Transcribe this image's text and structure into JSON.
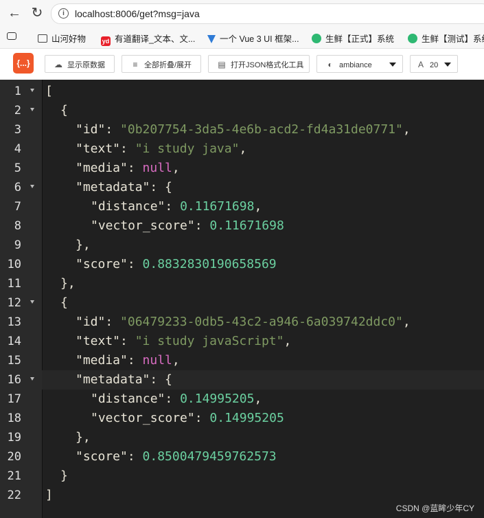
{
  "browser": {
    "url": "localhost:8006/get?msg=java",
    "bookmarks": [
      {
        "label": "山河好物",
        "icon": "folder-icon",
        "color": "#444444"
      },
      {
        "label": "有道翻译_文本、文...",
        "icon": "youdao-icon",
        "color": "#e8202a"
      },
      {
        "label": "一个 Vue 3 UI 框架...",
        "icon": "vue-icon",
        "color": "#2f7bd6"
      },
      {
        "label": "生鲜【正式】系统",
        "icon": "app-icon",
        "color": "#2eb872"
      },
      {
        "label": "生鲜【测试】系统",
        "icon": "app-icon",
        "color": "#2eb872"
      }
    ]
  },
  "toolbar": {
    "logo_text": "{...}",
    "show_raw": "显示原数据",
    "fold_all": "全部折叠/展开",
    "open_tool": "打开JSON格式化工具",
    "theme": "ambiance",
    "font_size": "20"
  },
  "editor": {
    "active_line": 16,
    "lines": [
      {
        "n": "1",
        "fold": true,
        "indent": 0,
        "tokens": [
          {
            "t": "[",
            "c": "p"
          }
        ]
      },
      {
        "n": "2",
        "fold": true,
        "indent": 1,
        "tokens": [
          {
            "t": "{",
            "c": "p"
          }
        ]
      },
      {
        "n": "3",
        "fold": false,
        "indent": 2,
        "tokens": [
          {
            "t": "\"id\"",
            "c": "k"
          },
          {
            "t": ": ",
            "c": "p"
          },
          {
            "t": "\"0b207754-3da5-4e6b-acd2-fd4a31de0771\"",
            "c": "s"
          },
          {
            "t": ",",
            "c": "p"
          }
        ]
      },
      {
        "n": "4",
        "fold": false,
        "indent": 2,
        "tokens": [
          {
            "t": "\"text\"",
            "c": "k"
          },
          {
            "t": ": ",
            "c": "p"
          },
          {
            "t": "\"i study java\"",
            "c": "s"
          },
          {
            "t": ",",
            "c": "p"
          }
        ]
      },
      {
        "n": "5",
        "fold": false,
        "indent": 2,
        "tokens": [
          {
            "t": "\"media\"",
            "c": "k"
          },
          {
            "t": ": ",
            "c": "p"
          },
          {
            "t": "null",
            "c": "nl"
          },
          {
            "t": ",",
            "c": "p"
          }
        ]
      },
      {
        "n": "6",
        "fold": true,
        "indent": 2,
        "tokens": [
          {
            "t": "\"metadata\"",
            "c": "k"
          },
          {
            "t": ": {",
            "c": "p"
          }
        ]
      },
      {
        "n": "7",
        "fold": false,
        "indent": 3,
        "tokens": [
          {
            "t": "\"distance\"",
            "c": "k"
          },
          {
            "t": ": ",
            "c": "p"
          },
          {
            "t": "0.11671698",
            "c": "n"
          },
          {
            "t": ",",
            "c": "p"
          }
        ]
      },
      {
        "n": "8",
        "fold": false,
        "indent": 3,
        "tokens": [
          {
            "t": "\"vector_score\"",
            "c": "k"
          },
          {
            "t": ": ",
            "c": "p"
          },
          {
            "t": "0.11671698",
            "c": "n"
          }
        ]
      },
      {
        "n": "9",
        "fold": false,
        "indent": 2,
        "tokens": [
          {
            "t": "},",
            "c": "p"
          }
        ]
      },
      {
        "n": "10",
        "fold": false,
        "indent": 2,
        "tokens": [
          {
            "t": "\"score\"",
            "c": "k"
          },
          {
            "t": ": ",
            "c": "p"
          },
          {
            "t": "0.8832830190658569",
            "c": "n"
          }
        ]
      },
      {
        "n": "11",
        "fold": false,
        "indent": 1,
        "tokens": [
          {
            "t": "},",
            "c": "p"
          }
        ]
      },
      {
        "n": "12",
        "fold": true,
        "indent": 1,
        "tokens": [
          {
            "t": "{",
            "c": "p"
          }
        ]
      },
      {
        "n": "13",
        "fold": false,
        "indent": 2,
        "tokens": [
          {
            "t": "\"id\"",
            "c": "k"
          },
          {
            "t": ": ",
            "c": "p"
          },
          {
            "t": "\"06479233-0db5-43c2-a946-6a039742ddc0\"",
            "c": "s"
          },
          {
            "t": ",",
            "c": "p"
          }
        ]
      },
      {
        "n": "14",
        "fold": false,
        "indent": 2,
        "tokens": [
          {
            "t": "\"text\"",
            "c": "k"
          },
          {
            "t": ": ",
            "c": "p"
          },
          {
            "t": "\"i study javaScript\"",
            "c": "s"
          },
          {
            "t": ",",
            "c": "p"
          }
        ]
      },
      {
        "n": "15",
        "fold": false,
        "indent": 2,
        "tokens": [
          {
            "t": "\"media\"",
            "c": "k"
          },
          {
            "t": ": ",
            "c": "p"
          },
          {
            "t": "null",
            "c": "nl"
          },
          {
            "t": ",",
            "c": "p"
          }
        ]
      },
      {
        "n": "16",
        "fold": true,
        "indent": 2,
        "tokens": [
          {
            "t": "\"metadata\"",
            "c": "k"
          },
          {
            "t": ": {",
            "c": "p"
          }
        ]
      },
      {
        "n": "17",
        "fold": false,
        "indent": 3,
        "tokens": [
          {
            "t": "\"distance\"",
            "c": "k"
          },
          {
            "t": ": ",
            "c": "p"
          },
          {
            "t": "0.14995205",
            "c": "n"
          },
          {
            "t": ",",
            "c": "p"
          }
        ]
      },
      {
        "n": "18",
        "fold": false,
        "indent": 3,
        "tokens": [
          {
            "t": "\"vector_score\"",
            "c": "k"
          },
          {
            "t": ": ",
            "c": "p"
          },
          {
            "t": "0.14995205",
            "c": "n"
          }
        ]
      },
      {
        "n": "19",
        "fold": false,
        "indent": 2,
        "tokens": [
          {
            "t": "},",
            "c": "p"
          }
        ]
      },
      {
        "n": "20",
        "fold": false,
        "indent": 2,
        "tokens": [
          {
            "t": "\"score\"",
            "c": "k"
          },
          {
            "t": ": ",
            "c": "p"
          },
          {
            "t": "0.8500479459762573",
            "c": "n"
          }
        ]
      },
      {
        "n": "21",
        "fold": false,
        "indent": 1,
        "tokens": [
          {
            "t": "}",
            "c": "p"
          }
        ]
      },
      {
        "n": "22",
        "fold": false,
        "indent": 0,
        "tokens": [
          {
            "t": "]",
            "c": "p"
          }
        ]
      }
    ]
  },
  "watermark": "CSDN @蓝眸少年CY"
}
